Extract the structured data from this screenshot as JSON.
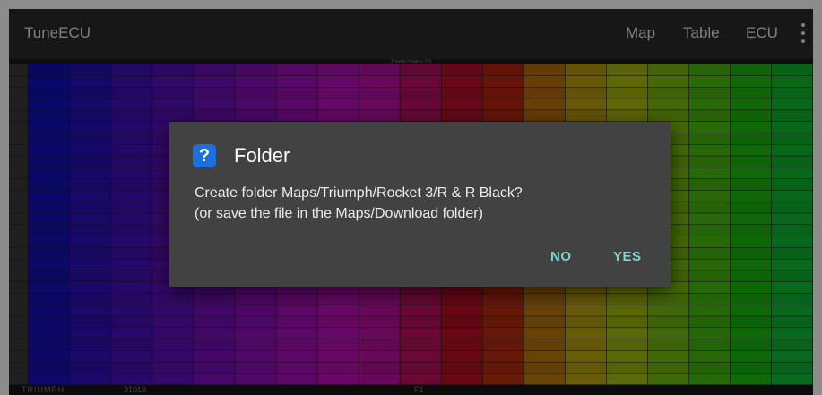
{
  "appbar": {
    "title": "TuneECU",
    "menu": [
      "Map",
      "Table",
      "ECU"
    ],
    "overflow_icon": "more-vert-icon"
  },
  "table": {
    "caption": "Throttle Position (%)"
  },
  "statusbar": {
    "model": "TRIUMPH",
    "id": "31018",
    "mark": "F1"
  },
  "dialog": {
    "icon": "question-icon",
    "icon_glyph": "?",
    "title": "Folder",
    "message_line1": "Create folder Maps/Triumph/Rocket 3/R & R Black?",
    "message_line2": "(or save the file in the Maps/Download folder)",
    "no_label": "NO",
    "yes_label": "YES"
  },
  "colors": {
    "appbar": "#2b2b2b",
    "dialog": "#424242",
    "accent": "#7fd3cc",
    "icon_bg": "#1e6fd9"
  }
}
